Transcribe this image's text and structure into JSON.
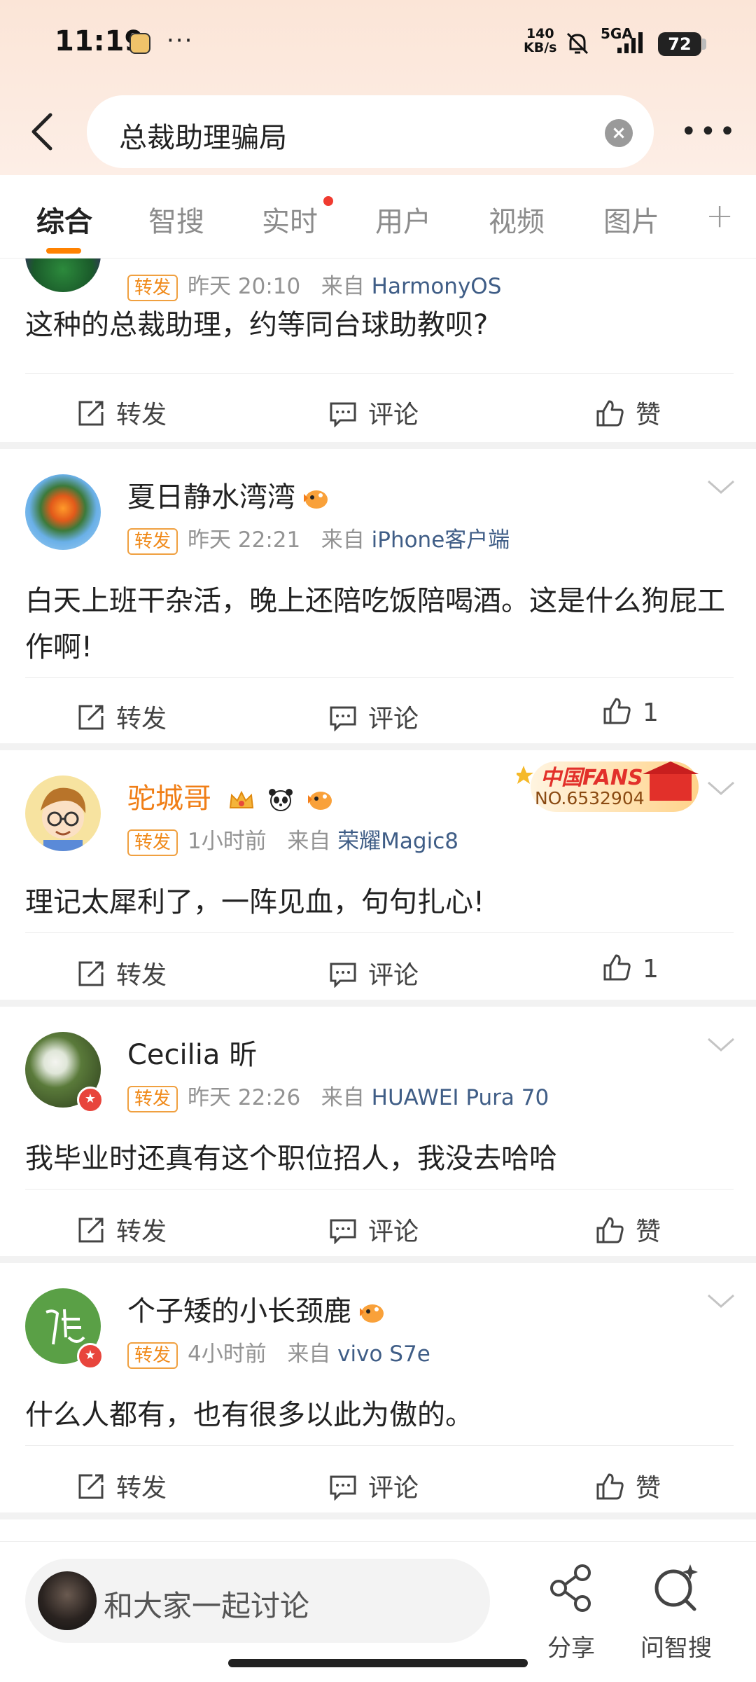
{
  "status_bar": {
    "time": "11:19",
    "dots": "···",
    "net_speed_value": "140",
    "net_speed_unit": "KB/s",
    "signal": "5GA",
    "battery": "72"
  },
  "header": {
    "search_query": "总裁助理骗局"
  },
  "tabs": [
    {
      "label": "综合",
      "active": true
    },
    {
      "label": "智搜"
    },
    {
      "label": "实时",
      "dot": true
    },
    {
      "label": "用户"
    },
    {
      "label": "视频"
    },
    {
      "label": "图片"
    }
  ],
  "posts": [
    {
      "tag": "转发",
      "time": "昨天 20:10",
      "source_prefix": "来自",
      "source": "HarmonyOS",
      "content": "这种的总裁助理，约等同台球助教呗?",
      "repost": "转发",
      "comment": "评论",
      "like": "赞"
    },
    {
      "name": "夏日静水湾湾",
      "tag": "转发",
      "time": "昨天 22:21",
      "source_prefix": "来自",
      "source": "iPhone客户端",
      "content": "白天上班干杂活，晚上还陪吃饭陪喝酒。这是什么狗屁工作啊!",
      "repost": "转发",
      "comment": "评论",
      "like": "1"
    },
    {
      "name": "驼城哥",
      "tag": "转发",
      "time": "1小时前",
      "source_prefix": "来自",
      "source": "荣耀Magic8",
      "content": "理记太犀利了，一阵见血，句句扎心!",
      "fans_badge_title": "中国FANS",
      "fans_badge_no": "NO.6532904",
      "repost": "转发",
      "comment": "评论",
      "like": "1"
    },
    {
      "name": "Cecilia 昕",
      "tag": "转发",
      "time": "昨天 22:26",
      "source_prefix": "来自",
      "source": "HUAWEI Pura 70",
      "content": "我毕业时还真有这个职位招人，我没去哈哈",
      "repost": "转发",
      "comment": "评论",
      "like": "赞"
    },
    {
      "name": "个子矮的小长颈鹿",
      "tag": "转发",
      "time": "4小时前",
      "source_prefix": "来自",
      "source": "vivo S7e",
      "content": "什么人都有，也有很多以此为傲的。",
      "repost": "转发",
      "comment": "评论",
      "like": "赞"
    }
  ],
  "bottom_bar": {
    "comment_placeholder": "和大家一起讨论",
    "share_label": "分享",
    "ask_label": "问智搜"
  },
  "colors": {
    "accent": "#ff8200",
    "link": "#3f5d86",
    "header_bg": "#fbe5d7"
  }
}
